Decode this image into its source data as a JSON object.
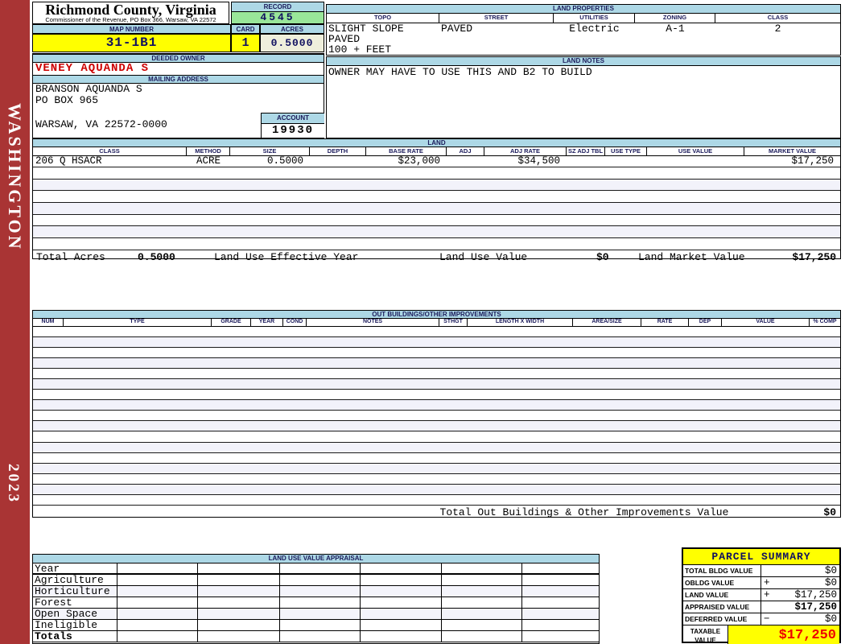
{
  "sidebar": {
    "state": "WASHINGTON",
    "year": "2023"
  },
  "header": {
    "county": "Richmond County, Virginia",
    "commissioner": "Commissioner of the Revenue, PO Box 366, Warsaw, VA 22572"
  },
  "record": {
    "label": "RECORD",
    "value": "4545"
  },
  "map": {
    "label": "MAP NUMBER",
    "value": "31-1B1"
  },
  "card": {
    "label": "CARD",
    "value": "1"
  },
  "acres": {
    "label": "ACRES",
    "value": "0.5000"
  },
  "owner": {
    "label": "DEEDED OWNER",
    "name": "VENEY AQUANDA S"
  },
  "mailing": {
    "label": "MAILING ADDRESS",
    "line1": "BRANSON AQUANDA S",
    "line2": "PO BOX 965",
    "line3": "WARSAW, VA 22572-0000"
  },
  "account": {
    "label": "ACCOUNT",
    "value": "19930"
  },
  "land_properties": {
    "title": "LAND PROPERTIES",
    "columns": [
      "TOPO",
      "STREET",
      "UTILITIES",
      "ZONING",
      "CLASS"
    ],
    "row1": [
      "SLIGHT SLOPE",
      "PAVED",
      "Electric",
      "A-1",
      "2"
    ],
    "row2": "PAVED",
    "row3": "100 + FEET"
  },
  "land_notes": {
    "title": "LAND NOTES",
    "note": "OWNER MAY HAVE TO USE THIS AND B2 TO BUILD"
  },
  "land": {
    "title": "LAND",
    "columns": [
      "CLASS",
      "METHOD",
      "SIZE",
      "DEPTH",
      "BASE RATE",
      "ADJ",
      "ADJ RATE",
      "SZ ADJ TBL",
      "USE TYPE",
      "USE VALUE",
      "MARKET VALUE"
    ],
    "row": {
      "class": "206 Q HSACR",
      "method": "ACRE",
      "size": "0.5000",
      "base_rate": "$23,000",
      "adj_rate": "$34,500",
      "market_value": "$17,250"
    },
    "totals": {
      "acres_label": "Total Acres",
      "acres": "0.5000",
      "eff_year_label": "Land Use Effective Year",
      "use_value_label": "Land Use Value",
      "use_value": "$0",
      "market_label": "Land Market Value",
      "market_value": "$17,250"
    }
  },
  "out_buildings": {
    "title": "OUT BUILDINGS/OTHER IMPROVEMENTS",
    "columns": [
      "NUM",
      "TYPE",
      "GRADE",
      "YEAR",
      "COND",
      "NOTES",
      "STHGT",
      "LENGTH X WIDTH",
      "AREA/SIZE",
      "RATE",
      "DEP",
      "VALUE",
      "% COMP"
    ],
    "total_label": "Total Out Buildings & Other Improvements Value",
    "total_value": "$0"
  },
  "appraisal": {
    "title": "LAND USE VALUE APPRAISAL",
    "row_labels": [
      "Year",
      "Agriculture",
      "Horticulture",
      "Forest",
      "Open Space",
      "Ineligible",
      "Totals"
    ]
  },
  "parcel_summary": {
    "title": "PARCEL SUMMARY",
    "rows": [
      {
        "label": "TOTAL BLDG VALUE",
        "op": "",
        "value": "$0"
      },
      {
        "label": "OBLDG VALUE",
        "op": "+",
        "value": "$0"
      },
      {
        "label": "LAND VALUE",
        "op": "+",
        "value": "$17,250"
      },
      {
        "label": "APPRAISED VALUE",
        "op": "",
        "value": "$17,250"
      },
      {
        "label": "DEFERRED VALUE",
        "op": "−",
        "value": "$0"
      }
    ],
    "taxable_label_1": "TAXABLE",
    "taxable_label_2": "VALUE",
    "taxable_value": "$17,250"
  },
  "colors": {
    "sidebar_red": "#A93434",
    "header_blue": "#ADD8E6",
    "highlight_yellow": "#FFFF00",
    "record_green": "#99E699",
    "owner_red": "#CC0000",
    "taxable_red": "#EE0000"
  }
}
